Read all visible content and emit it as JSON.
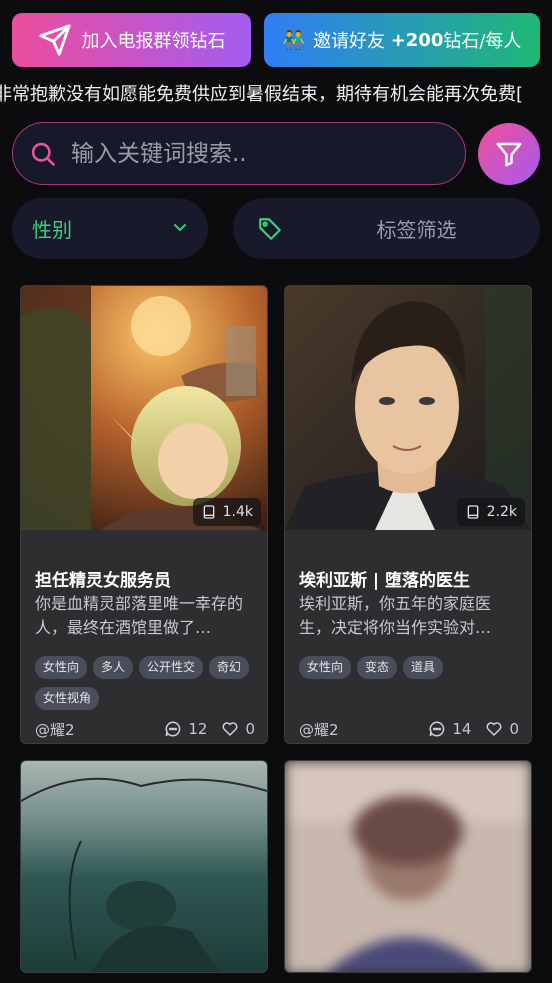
{
  "top_buttons": {
    "telegram_label": "加入电报群领钻石",
    "invite_emoji": "👬",
    "invite_label": "邀请好友",
    "invite_bonus": "+200",
    "invite_suffix": "钻石/每人"
  },
  "announcement": "非常抱歉没有如愿能免费供应到暑假结束，期待有机会能再次免费[",
  "search": {
    "placeholder": "输入关键词搜索.."
  },
  "filters": {
    "gender_label": "性别",
    "tags_label": "标签筛选"
  },
  "colors": {
    "accent_pink": "#ec4d9e",
    "accent_purple": "#a35df0",
    "accent_green": "#3ccf7c",
    "accent_blue": "#2f7ef5"
  },
  "cards": [
    {
      "count": "1.4k",
      "title": "担任精灵女服务员",
      "desc": "你是血精灵部落里唯一幸存的人，最终在酒馆里做了…",
      "tags": [
        "女性向",
        "多人",
        "公开性交",
        "奇幻",
        "女性视角"
      ],
      "author": "@耀2",
      "comments": "12",
      "likes": "0"
    },
    {
      "count": "2.2k",
      "title": "埃利亚斯 | 堕落的医生",
      "desc": "埃利亚斯，你五年的家庭医生，决定将你当作实验对…",
      "tags": [
        "女性向",
        "变态",
        "道具"
      ],
      "author": "@耀2",
      "comments": "14",
      "likes": "0"
    }
  ]
}
